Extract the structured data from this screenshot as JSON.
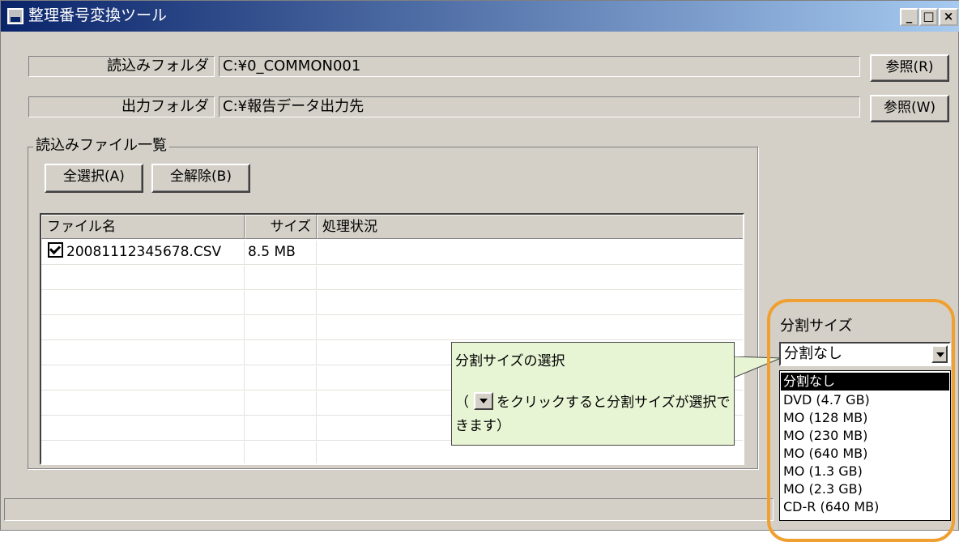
{
  "window": {
    "title": "整理番号変換ツール",
    "controls": {
      "minimize": "_",
      "maximize": "□",
      "close": "×"
    }
  },
  "read_folder": {
    "label": "読込みフォルダ",
    "path": "C:¥0_COMMON001",
    "browse_label": "参照(R)"
  },
  "output_folder": {
    "label": "出力フォルダ",
    "path": "C:¥報告データ出力先",
    "browse_label": "参照(W)"
  },
  "file_group": {
    "title": "読込みファイル一覧",
    "select_all_label": "全選択(A)",
    "deselect_all_label": "全解除(B)",
    "columns": [
      "ファイル名",
      "サイズ",
      "処理状況"
    ],
    "rows": [
      {
        "checked": true,
        "filename": "20081112345678.CSV",
        "size": "8.5 MB",
        "status": ""
      }
    ]
  },
  "split": {
    "label": "分割サイズ",
    "selected": "分割なし",
    "options": [
      "分割なし",
      "DVD (4.7 GB)",
      "MO (128 MB)",
      "MO (230 MB)",
      "MO (640 MB)",
      "MO (1.3 GB)",
      "MO (2.3 GB)",
      "CD-R (640 MB)"
    ]
  },
  "callout": {
    "title": "分割サイズの選択",
    "open_paren": "（",
    "body_rest": "をクリックすると分割サイズが選択できます）"
  },
  "colors": {
    "highlight": "#f0a030",
    "callout_bg": "#e8f5d4",
    "titlebar": "#0a246a"
  }
}
